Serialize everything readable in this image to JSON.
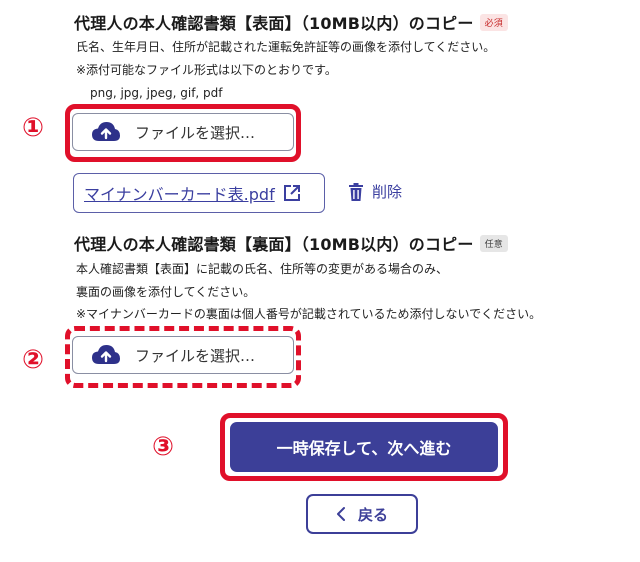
{
  "section1": {
    "title": "代理人の本人確認書類【表面】（10MB以内）のコピー",
    "badge": "必須",
    "desc_line1": "氏名、生年月日、住所が記載された運転免許証等の画像を添付してください。",
    "desc_line2": "※添付可能なファイル形式は以下のとおりです。",
    "formats": "png, jpg, jpeg, gif, pdf",
    "file_button_label": "ファイルを選択…",
    "attached_file": "マイナンバーカード表.pdf",
    "delete_label": "削除"
  },
  "section2": {
    "title": "代理人の本人確認書類【裏面】（10MB以内）のコピー",
    "badge": "任意",
    "desc_line1": "本人確認書類【表面】に記載の氏名、住所等の変更がある場合のみ、",
    "desc_line2": "裏面の画像を添付してください。",
    "desc_line3": "※マイナンバーカードの裏面は個人番号が記載されているため添付しないでください。",
    "file_button_label": "ファイルを選択…"
  },
  "steps": {
    "step1": "①",
    "step2": "②",
    "step3": "③"
  },
  "actions": {
    "save_next_label": "一時保存して、次へ進む",
    "back_label": "戻る"
  },
  "colors": {
    "primary": "#3c3f98",
    "highlight": "#e0102a",
    "link": "#3b3fa0"
  }
}
